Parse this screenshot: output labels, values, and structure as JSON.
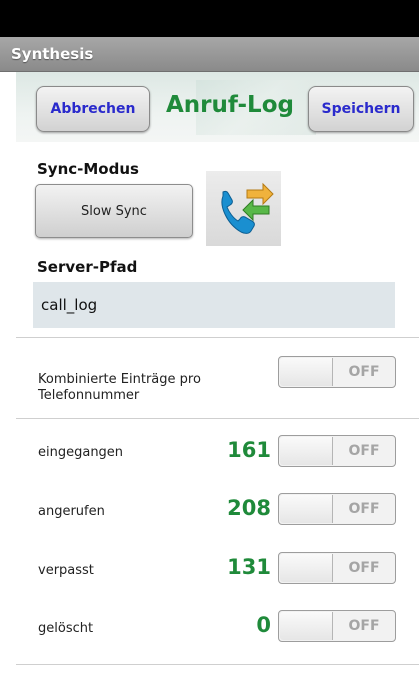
{
  "app": {
    "title": "Synthesis"
  },
  "header": {
    "cancel_label": "Abbrechen",
    "title": "Anruf-Log",
    "save_label": "Speichern"
  },
  "sync": {
    "label": "Sync-Modus",
    "button_label": "Slow Sync",
    "icon": "phone-call-log-icon"
  },
  "server": {
    "label": "Server-Pfad",
    "value": "call_log"
  },
  "combined": {
    "label": "Kombinierte Einträge pro Telefonnummer",
    "toggle": "OFF"
  },
  "rows": [
    {
      "label": "eingegangen",
      "count": "161",
      "toggle": "OFF"
    },
    {
      "label": "angerufen",
      "count": "208",
      "toggle": "OFF"
    },
    {
      "label": "verpasst",
      "count": "131",
      "toggle": "OFF"
    },
    {
      "label": "gelöscht",
      "count": "0",
      "toggle": "OFF"
    }
  ],
  "colors": {
    "accent_green": "#1f8a3a",
    "button_text_blue": "#2a2acc",
    "appbar_gray": "#9a9a9a"
  }
}
